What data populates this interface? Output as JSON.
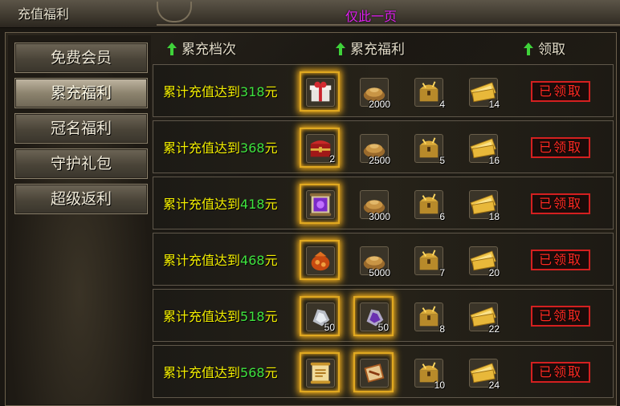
{
  "window_title": "充值福利",
  "page_label": "仅此一页",
  "colors": {
    "requirement_text": "#f5f000",
    "requirement_amount": "#3fe33f",
    "claimed_button": "#ff2a22",
    "page_label": "#e01ff0",
    "highlight_glow": "#ffb81c"
  },
  "nav": [
    {
      "label": "免费会员",
      "active": false
    },
    {
      "label": "累充福利",
      "active": true
    },
    {
      "label": "冠名福利",
      "active": false
    },
    {
      "label": "守护礼包",
      "active": false
    },
    {
      "label": "超级返利",
      "active": false
    }
  ],
  "headers": {
    "tier": "累充档次",
    "rewards": "累充福利",
    "claim": "领取",
    "arrow_icon": "green-up-arrow-icon"
  },
  "rows": [
    {
      "req_prefix": "累计充值达到",
      "amount": "318",
      "unit": "元",
      "items": [
        {
          "icon": "gift-box-icon",
          "qty": "",
          "highlight": true
        },
        {
          "icon": "ingot-pile-icon",
          "qty": "2000",
          "highlight": false
        },
        {
          "icon": "treasure-chest-icon",
          "qty": "4",
          "highlight": false
        },
        {
          "icon": "gold-ticket-icon",
          "qty": "14",
          "highlight": false
        }
      ],
      "claim_label": "已领取"
    },
    {
      "req_prefix": "累计充值达到",
      "amount": "368",
      "unit": "元",
      "items": [
        {
          "icon": "red-chest-icon",
          "qty": "2",
          "highlight": true
        },
        {
          "icon": "ingot-pile-icon",
          "qty": "2500",
          "highlight": false
        },
        {
          "icon": "treasure-chest-icon",
          "qty": "5",
          "highlight": false
        },
        {
          "icon": "gold-ticket-icon",
          "qty": "16",
          "highlight": false
        }
      ],
      "claim_label": "已领取"
    },
    {
      "req_prefix": "累计充值达到",
      "amount": "418",
      "unit": "元",
      "items": [
        {
          "icon": "purple-scroll-icon",
          "qty": "",
          "highlight": true
        },
        {
          "icon": "ingot-pile-icon",
          "qty": "3000",
          "highlight": false
        },
        {
          "icon": "treasure-chest-icon",
          "qty": "6",
          "highlight": false
        },
        {
          "icon": "gold-ticket-icon",
          "qty": "18",
          "highlight": false
        }
      ],
      "claim_label": "已领取"
    },
    {
      "req_prefix": "累计充值达到",
      "amount": "468",
      "unit": "元",
      "items": [
        {
          "icon": "orange-pouch-icon",
          "qty": "",
          "highlight": true
        },
        {
          "icon": "ingot-pile-icon",
          "qty": "5000",
          "highlight": false
        },
        {
          "icon": "treasure-chest-icon",
          "qty": "7",
          "highlight": false
        },
        {
          "icon": "gold-ticket-icon",
          "qty": "20",
          "highlight": false
        }
      ],
      "claim_label": "已领取"
    },
    {
      "req_prefix": "累计充值达到",
      "amount": "518",
      "unit": "元",
      "items": [
        {
          "icon": "silver-ore-icon",
          "qty": "50",
          "highlight": true
        },
        {
          "icon": "purple-ore-icon",
          "qty": "50",
          "highlight": true
        },
        {
          "icon": "treasure-chest-icon",
          "qty": "8",
          "highlight": false
        },
        {
          "icon": "gold-ticket-icon",
          "qty": "22",
          "highlight": false
        }
      ],
      "claim_label": "已领取"
    },
    {
      "req_prefix": "累计充值达到",
      "amount": "568",
      "unit": "元",
      "items": [
        {
          "icon": "gold-scroll-icon",
          "qty": "",
          "highlight": true
        },
        {
          "icon": "skill-book-icon",
          "qty": "",
          "highlight": true
        },
        {
          "icon": "treasure-chest-icon",
          "qty": "10",
          "highlight": false
        },
        {
          "icon": "gold-ticket-icon",
          "qty": "24",
          "highlight": false
        }
      ],
      "claim_label": "已领取"
    }
  ]
}
